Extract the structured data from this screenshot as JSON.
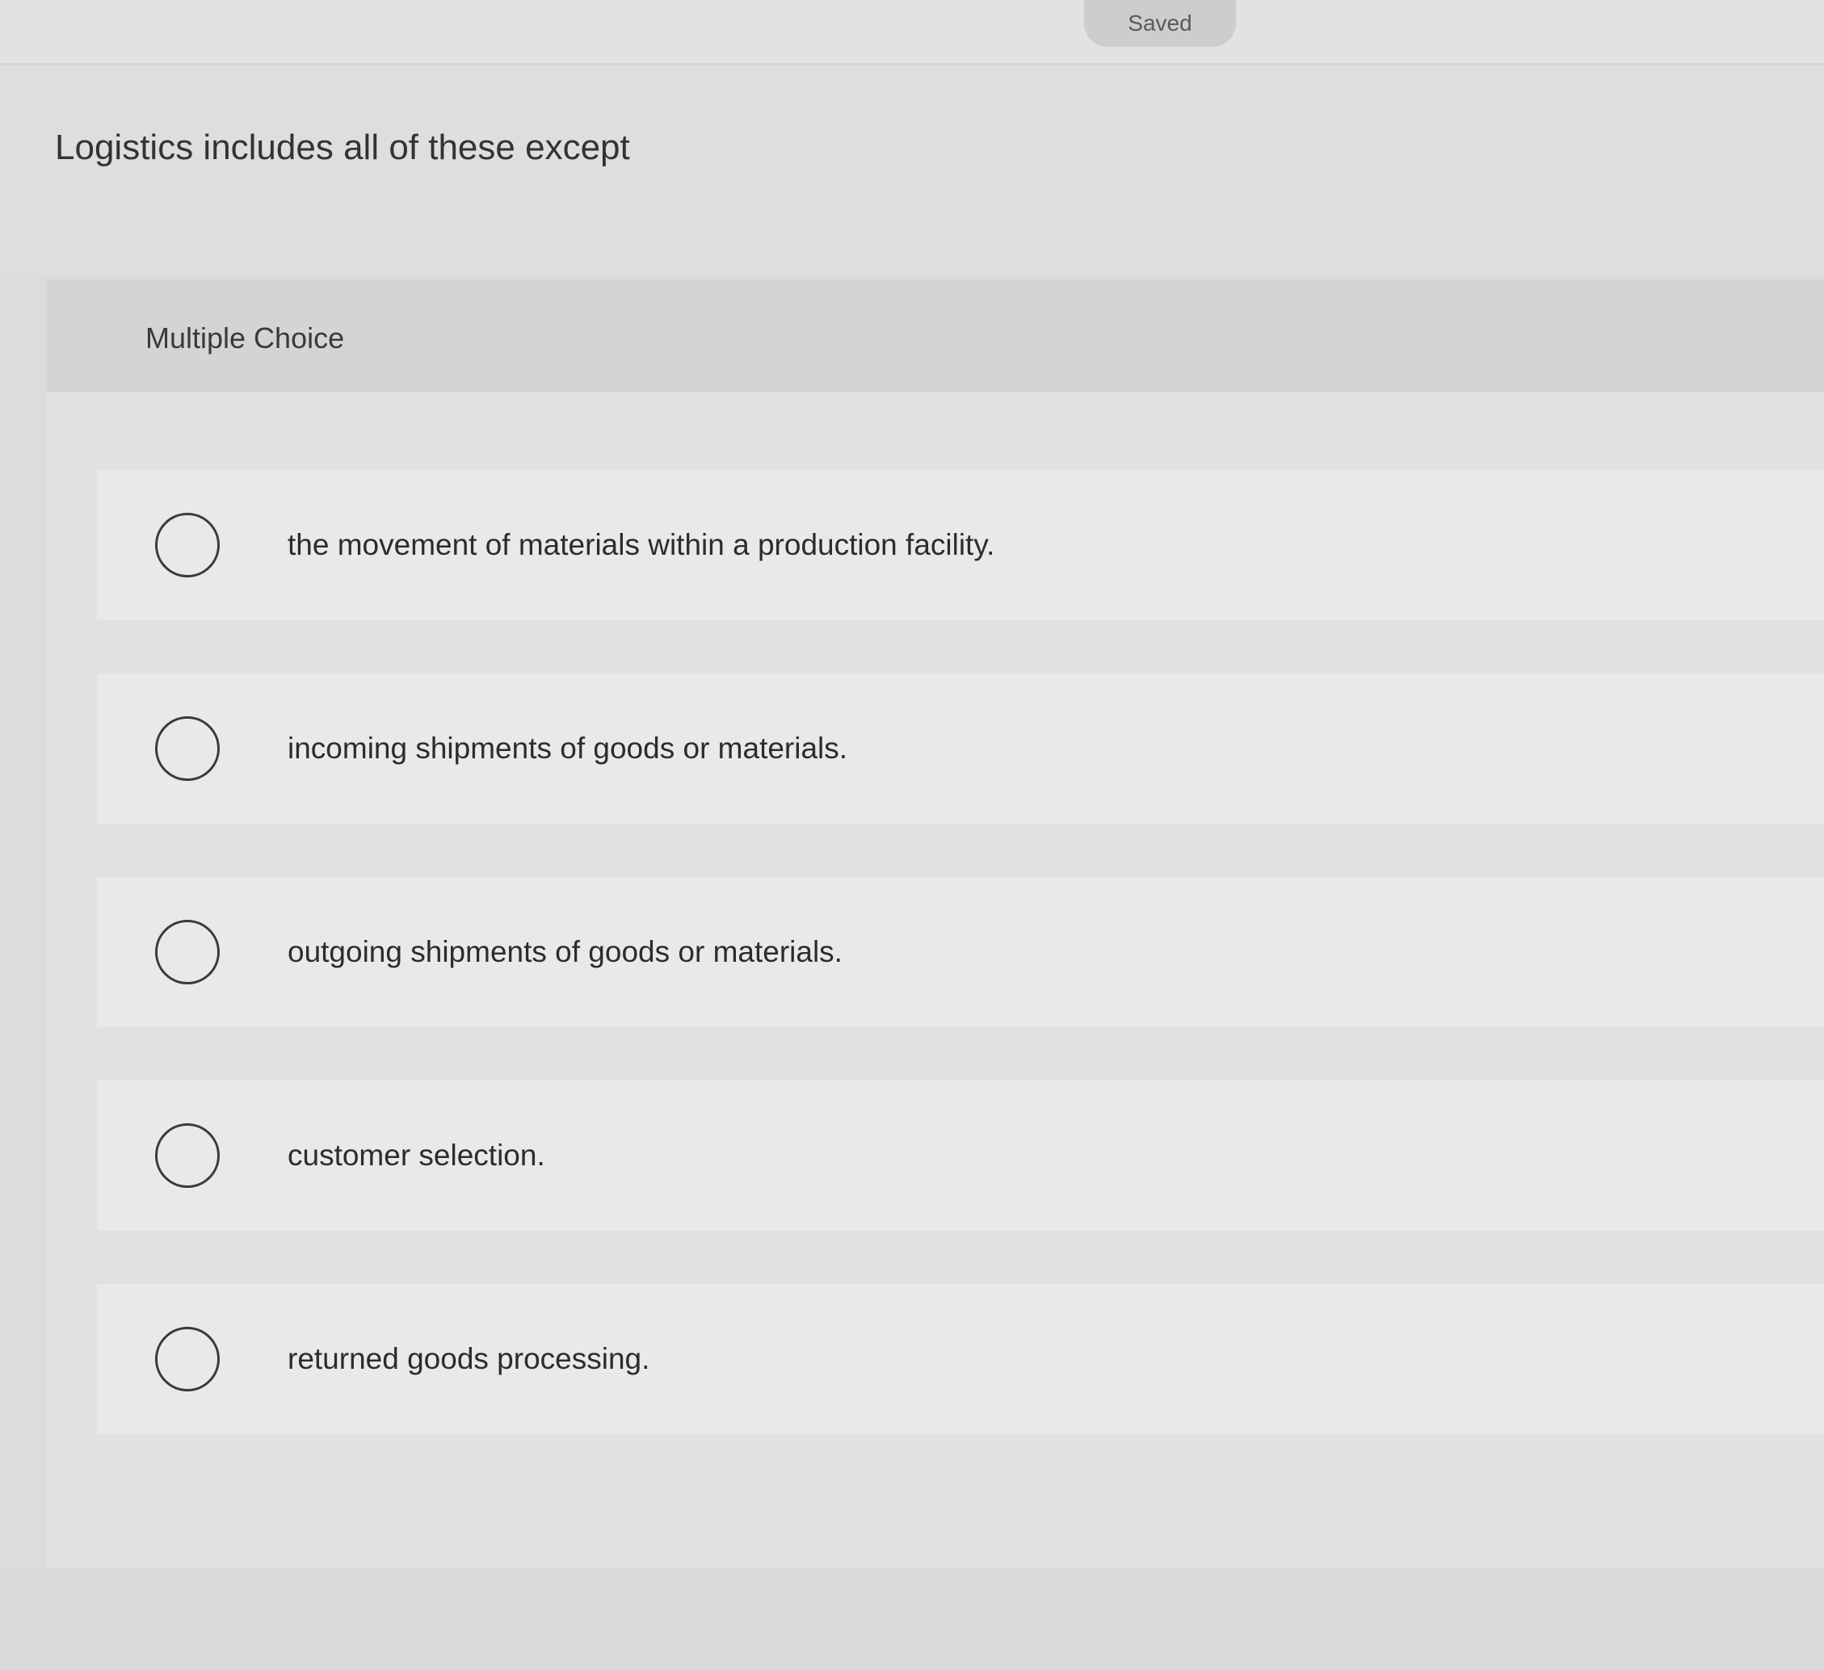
{
  "header": {
    "status_label": "Saved"
  },
  "question": {
    "prompt": "Logistics includes all of these except",
    "type_label": "Multiple Choice",
    "choices": [
      {
        "label": "the movement of materials within a production facility."
      },
      {
        "label": "incoming shipments of goods or materials."
      },
      {
        "label": "outgoing shipments of goods or materials."
      },
      {
        "label": "customer selection."
      },
      {
        "label": "returned goods processing."
      }
    ]
  }
}
